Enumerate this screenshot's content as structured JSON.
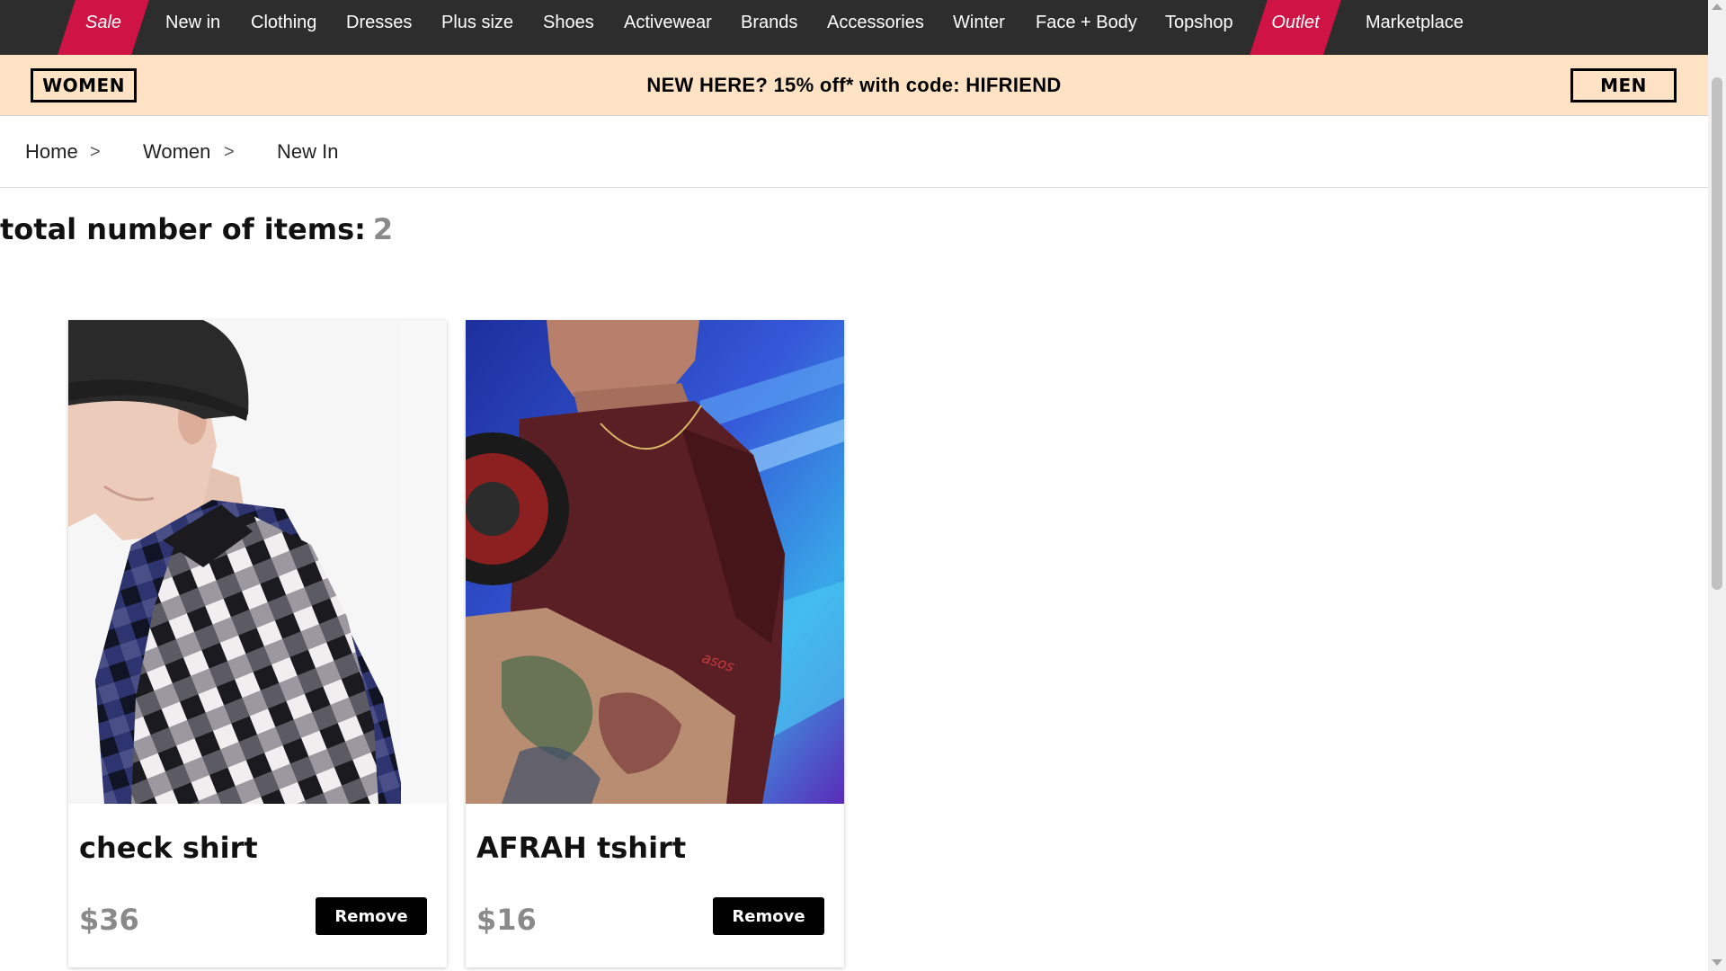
{
  "nav": {
    "items": [
      "Sale",
      "New in",
      "Clothing",
      "Dresses",
      "Plus size",
      "Shoes",
      "Activewear",
      "Brands",
      "Accessories",
      "Winter",
      "Face + Body",
      "Topshop",
      "Outlet",
      "Marketplace"
    ],
    "promo_color": "#d01345",
    "background": "#2d2d2d"
  },
  "banner": {
    "women_label": "WOMEN",
    "men_label": "MEN",
    "promo": "NEW HERE? 15% off* with code: HIFRIEND",
    "background": "#fde2c3"
  },
  "breadcrumb": {
    "items": [
      "Home",
      "Women",
      "New In"
    ],
    "separator": ">"
  },
  "summary": {
    "label": "total number of items:",
    "count": "2"
  },
  "products": [
    {
      "name": "check shirt",
      "price": "$36",
      "action": "Remove",
      "image": "model-in-beanie-wearing-check-shirt"
    },
    {
      "name": "AFRAH tshirt",
      "price": "$16",
      "action": "Remove",
      "image": "model-in-maroon-tshirt-lifting-dumbbell"
    }
  ]
}
